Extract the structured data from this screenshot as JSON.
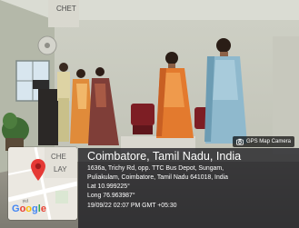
{
  "badge": {
    "text": "GPS Map Camera",
    "icon": "camera-icon"
  },
  "location": {
    "title": "Coimbatore, Tamil Nadu, India",
    "address_line1": "1636a, Trichy Rd, opp. TTC Bus Depot, Sungam,",
    "address_line2": "Puliakulam, Coimbatore, Tamil Nadu 641018, India",
    "lat": "Lat 10.999225°",
    "long": "Long 76.963987°",
    "datetime": "19/09/22 02:07 PM GMT +05:30"
  },
  "map": {
    "label_top": "CHE",
    "label_bottom": "LAY",
    "road_label": "Rd",
    "logo": [
      "G",
      "o",
      "o",
      "g",
      "l",
      "e"
    ],
    "marker_icon": "map-pin-icon"
  },
  "scene": {
    "sign_text": "CHET"
  }
}
